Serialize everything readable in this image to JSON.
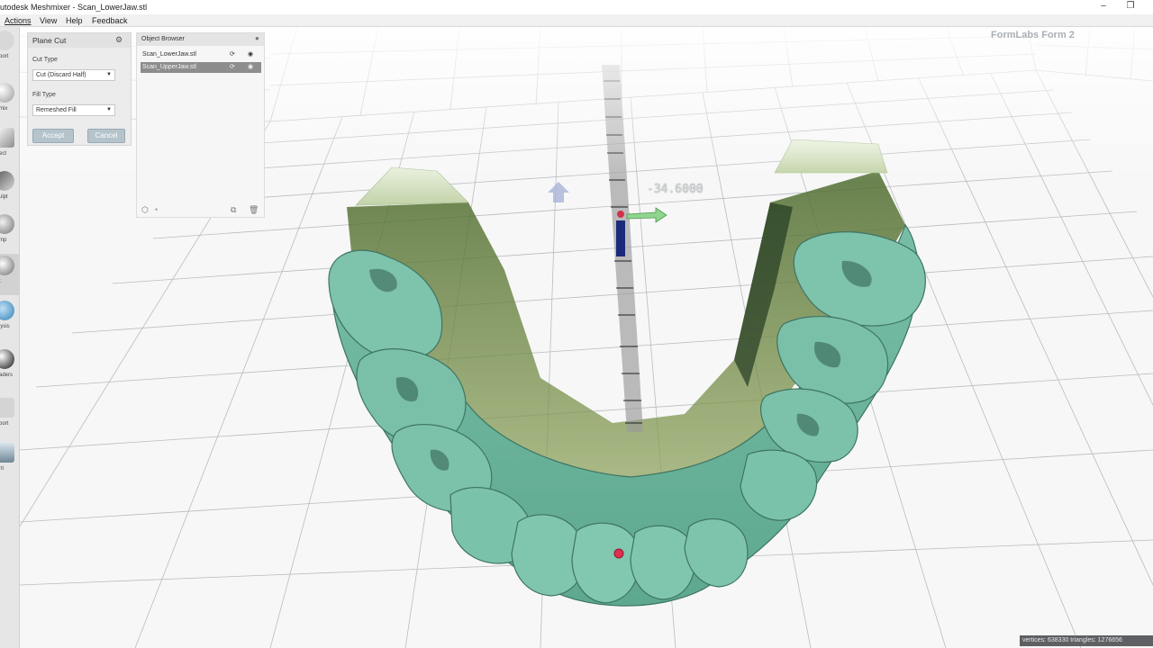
{
  "window": {
    "title": "Autodesk Meshmixer - Scan_LowerJaw.stl",
    "controls": {
      "minimize": "–",
      "restore": "❐"
    }
  },
  "menu": [
    "Actions",
    "View",
    "Help",
    "Feedback"
  ],
  "toolbar": {
    "items": [
      {
        "label": "Import",
        "icon": "import-icon"
      },
      {
        "label": "Meshmix",
        "icon": "meshmix-icon"
      },
      {
        "label": "Select",
        "icon": "select-icon"
      },
      {
        "label": "Sculpt",
        "icon": "sculpt-icon"
      },
      {
        "label": "Stamp",
        "icon": "stamp-icon"
      },
      {
        "label": "Edit",
        "icon": "edit-icon"
      },
      {
        "label": "Analysis",
        "icon": "analysis-icon"
      },
      {
        "label": "Shaders",
        "icon": "shaders-icon"
      },
      {
        "label": "Export",
        "icon": "export-icon"
      },
      {
        "label": "Print",
        "icon": "print-icon"
      }
    ],
    "visible_labels": [
      "port",
      "mix",
      "ect",
      "ulpt",
      "mp",
      "t",
      "lysis",
      "aders",
      "port",
      "nt"
    ]
  },
  "plane_cut": {
    "title": "Plane Cut",
    "cut_type_label": "Cut Type",
    "cut_type_value": "Cut (Discard Half)",
    "fill_type_label": "Fill Type",
    "fill_type_value": "Remeshed Fill",
    "accept_label": "Accept",
    "cancel_label": "Cancel"
  },
  "object_browser": {
    "title": "Object Browser",
    "items": [
      {
        "name": "Scan_LowerJaw.stl",
        "selected": false
      },
      {
        "name": "Scan_UpperJaw.stl",
        "selected": true
      }
    ]
  },
  "viewport": {
    "printer_label": "FormLabs Form 2",
    "measurement": "-34.6000",
    "stats": "vertices: 638330 triangles: 1276656"
  },
  "colors": {
    "model": "#7fc4ac",
    "model_shadow": "#3f7d6a",
    "cut_plane": "#6e8a3e",
    "grid": "#b9bdc0",
    "accept_button": "#b5c3cb"
  }
}
